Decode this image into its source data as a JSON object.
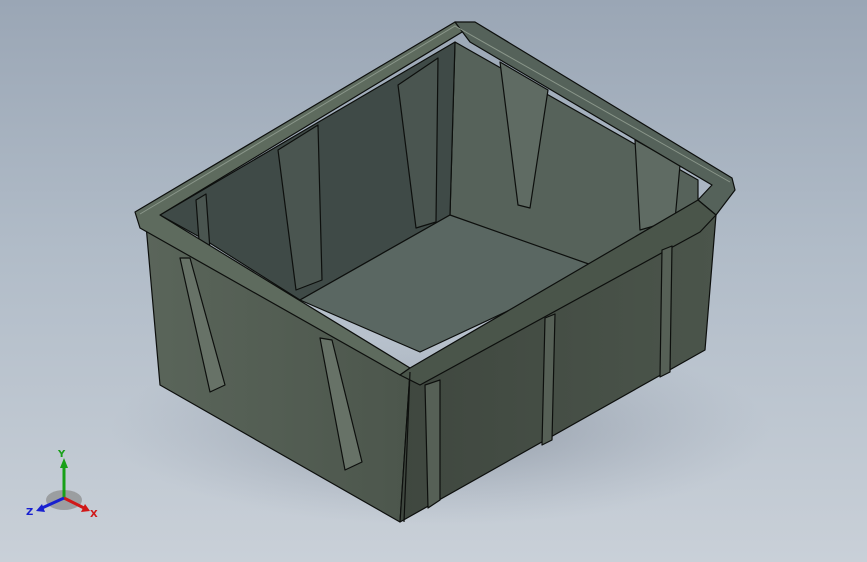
{
  "viewport": {
    "background_top": "#9aa6b5",
    "background_bottom": "#c9d0d8"
  },
  "model": {
    "body_color": "#4f5a4f",
    "interior_color": "#59665e",
    "edge_color": "#0d0f0d"
  },
  "triad": {
    "x_label": "X",
    "y_label": "Y",
    "z_label": "Z",
    "x_color": "#d01818",
    "y_color": "#18a018",
    "z_color": "#1820d0"
  }
}
